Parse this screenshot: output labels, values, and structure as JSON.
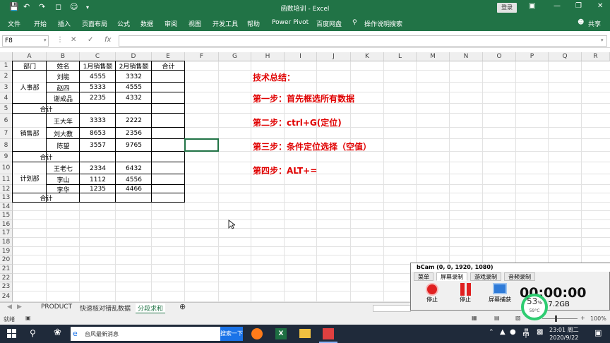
{
  "titlebar": {
    "title": "函数培训  -  Excel",
    "login": "登录",
    "icons": [
      "save-icon",
      "undo-icon",
      "redo-icon",
      "touch-icon",
      "user-icon",
      "dropdown-icon"
    ]
  },
  "menu": {
    "items": [
      "文件",
      "开始",
      "插入",
      "页面布局",
      "公式",
      "数据",
      "审阅",
      "视图",
      "开发工具",
      "帮助",
      "Power Pivot",
      "百度网盘"
    ],
    "tell_me": "操作说明搜索",
    "share": "共享"
  },
  "formula_bar": {
    "name_box": "F8",
    "fx": "fx",
    "value": ""
  },
  "columns": [
    "A",
    "B",
    "C",
    "D",
    "E",
    "F",
    "G",
    "H",
    "I",
    "J",
    "K",
    "L",
    "M",
    "N",
    "O",
    "P",
    "Q",
    "R"
  ],
  "rows": [
    "1",
    "2",
    "3",
    "4",
    "5",
    "6",
    "7",
    "8",
    "9",
    "10",
    "11",
    "12",
    "13",
    "14",
    "15",
    "16",
    "17",
    "18",
    "19",
    "20",
    "21",
    "22",
    "23",
    "24"
  ],
  "table": {
    "headers": [
      "部门",
      "姓名",
      "1月销售额",
      "2月销售额",
      "合计"
    ],
    "groups": [
      {
        "dept": "人事部",
        "rows": [
          [
            "刘能",
            "4555",
            "3332"
          ],
          [
            "赵四",
            "5333",
            "4555"
          ],
          [
            "谢成品",
            "2235",
            "4332"
          ]
        ],
        "subtotal": "合计"
      },
      {
        "dept": "销售部",
        "rows": [
          [
            "王大年",
            "3333",
            "2222"
          ],
          [
            "刘大教",
            "8653",
            "2356"
          ],
          [
            "陈望",
            "3557",
            "9765"
          ]
        ],
        "subtotal": "合计"
      },
      {
        "dept": "计划部",
        "rows": [
          [
            "王老七",
            "2334",
            "6432"
          ],
          [
            "李山",
            "1112",
            "4556"
          ],
          [
            "李华",
            "1235",
            "4466"
          ]
        ],
        "subtotal": "合计"
      }
    ]
  },
  "notes": {
    "title": "技术总结：",
    "step1": "第一步：首先框选所有数据",
    "step2": "第二步：ctrl+G(定位)",
    "step3": "第三步：条件定位选择（空值）",
    "step4": "第四步：ALT+="
  },
  "sheets": {
    "tabs": [
      "PRODUCT",
      "快速核对错乱数据",
      "分段求和"
    ],
    "active": "分段求和"
  },
  "status": {
    "ready": "就绪",
    "zoom": "100%"
  },
  "bandicam": {
    "title": "bCam (0, 0, 1920, 1080)",
    "tabs": [
      "菜单",
      "屏幕录制",
      "游戏录制",
      "音频录制"
    ],
    "buttons": [
      "停止",
      "停止",
      "屏幕捕获"
    ],
    "timer": "00:00:00",
    "size": "17.2GB"
  },
  "gauge": {
    "percent": "53",
    "unit": "%",
    "temp": "59°C"
  },
  "taskbar": {
    "search_text": "台风最新消息",
    "search_btn": "搜索一下",
    "ime": "中",
    "time": "23:01 周二",
    "date": "2020/9/22"
  }
}
